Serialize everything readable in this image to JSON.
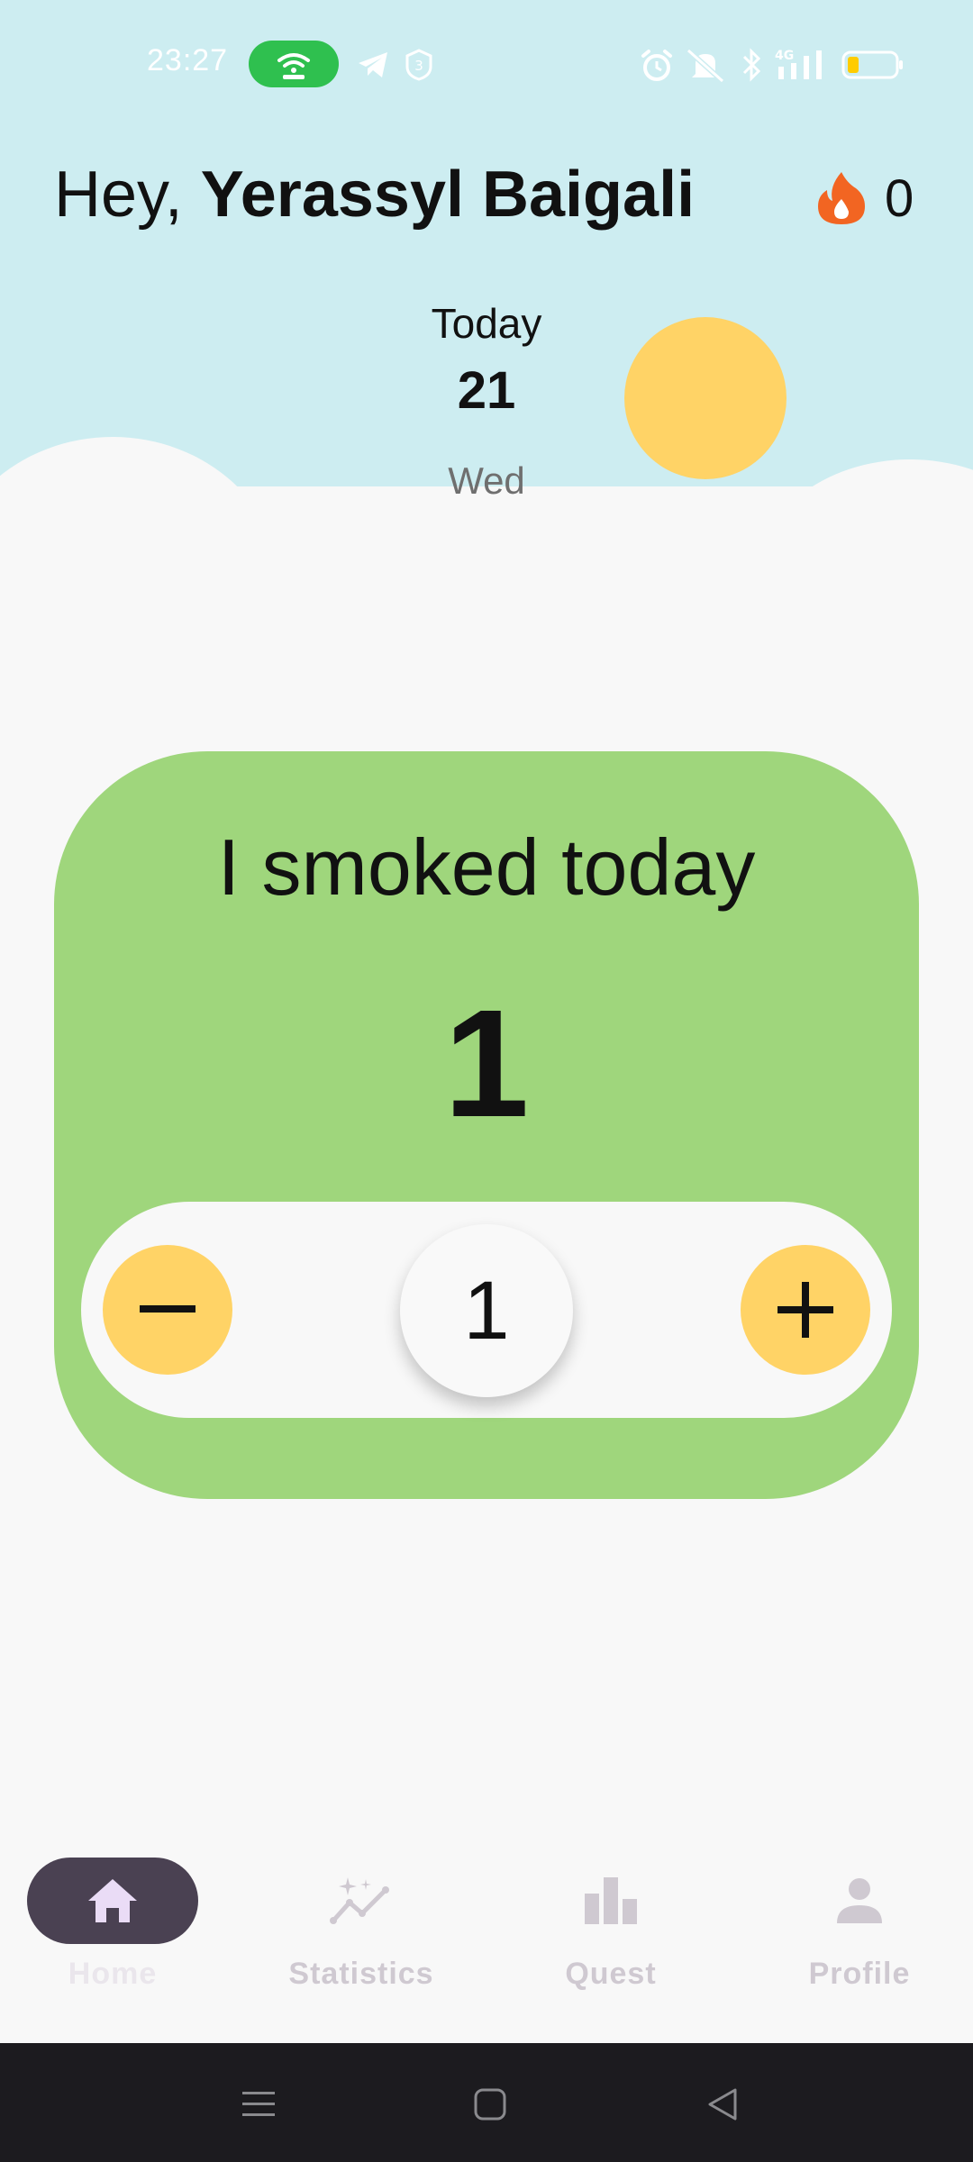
{
  "status_bar": {
    "time": "23:27",
    "hotspot_badge": "hotspot-icon",
    "notification_badge": "3",
    "icons": [
      "telegram-icon",
      "notification-count-icon",
      "alarm-icon",
      "mute-icon",
      "bluetooth-icon",
      "signal-4g-icon",
      "battery-low-icon"
    ]
  },
  "header": {
    "greeting_prefix": "Hey, ",
    "user_name": "Yerassyl Baigali",
    "streak_icon": "fire-icon",
    "streak_count": "0"
  },
  "date": {
    "label": "Today",
    "day": "21",
    "weekday": "Wed"
  },
  "smoked_card": {
    "title": "I smoked today",
    "count": "1",
    "stepper_value": "1",
    "minus_icon": "minus-icon",
    "plus_icon": "plus-icon"
  },
  "bottom_nav": {
    "items": [
      {
        "label": "Home",
        "icon": "home-icon",
        "active": true
      },
      {
        "label": "Statistics",
        "icon": "statistics-icon",
        "active": false
      },
      {
        "label": "Quest",
        "icon": "bar-chart-icon",
        "active": false
      },
      {
        "label": "Profile",
        "icon": "person-icon",
        "active": false
      }
    ]
  },
  "system_nav": {
    "icons": [
      "menu-icon",
      "home-square-icon",
      "back-icon"
    ]
  },
  "colors": {
    "sky": "#cdedf1",
    "background": "#f8f8f8",
    "card_green": "#9fd67c",
    "accent_yellow": "#ffd366",
    "hotspot_green": "#2fc04f",
    "fire_orange": "#f26522",
    "nav_active": "#4a4152",
    "nav_inactive_text": "#cfc9d1",
    "system_nav": "#1c1b1f"
  }
}
